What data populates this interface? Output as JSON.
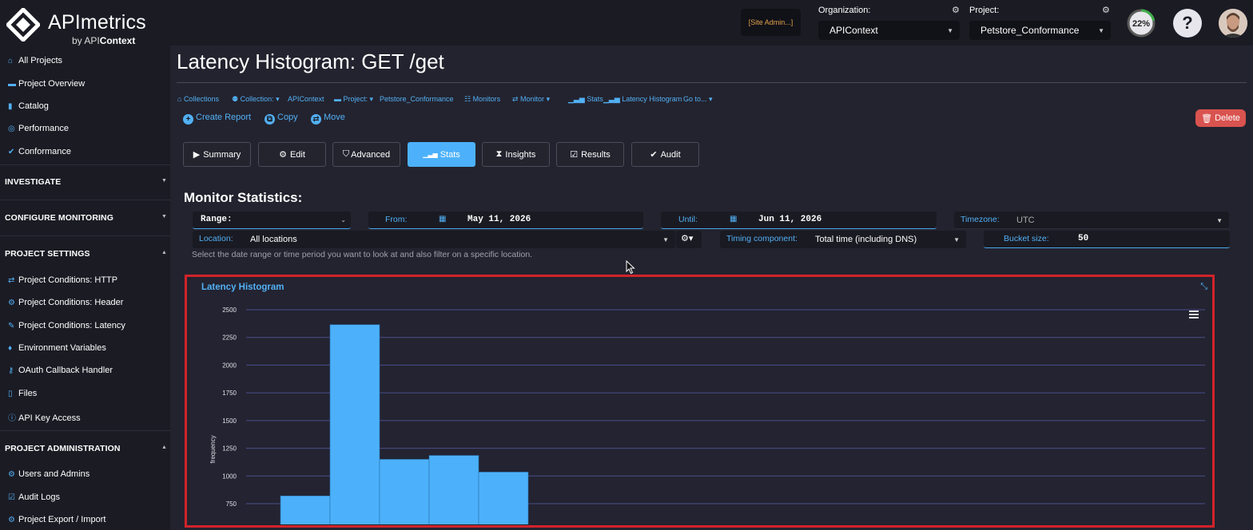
{
  "brand": {
    "title": "APImetrics",
    "sub_prefix": "by API",
    "sub_bold": "Context"
  },
  "header": {
    "site_admin": "[Site Admin...]",
    "org_label": "Organization:",
    "org_value": "APIContext",
    "project_label": "Project:",
    "project_value": "Petstore_Conformance",
    "gauge_text": "22%",
    "gauge_percent": 22,
    "help": "?"
  },
  "sidebar": {
    "top_items": [
      {
        "icon": "home-icon",
        "label": "All Projects"
      },
      {
        "icon": "folder-icon",
        "label": "Project Overview"
      },
      {
        "icon": "book-icon",
        "label": "Catalog"
      },
      {
        "icon": "gauge-icon",
        "label": "Performance"
      },
      {
        "icon": "check-icon",
        "label": "Conformance"
      }
    ],
    "investigate": "INVESTIGATE",
    "configure": "CONFIGURE MONITORING",
    "project_settings": "PROJECT SETTINGS",
    "settings_items": [
      {
        "icon": "exchange-icon",
        "label": "Project Conditions: HTTP"
      },
      {
        "icon": "gear-icon",
        "label": "Project Conditions: Header"
      },
      {
        "icon": "wrench-icon",
        "label": "Project Conditions: Latency"
      },
      {
        "icon": "leaf-icon",
        "label": "Environment Variables"
      },
      {
        "icon": "key-icon",
        "label": "OAuth Callback Handler"
      },
      {
        "icon": "file-icon",
        "label": "Files"
      },
      {
        "icon": "info-icon",
        "label": "API Key Access"
      }
    ],
    "project_admin": "PROJECT ADMINISTRATION",
    "admin_items": [
      {
        "icon": "gear-icon",
        "label": "Users and Admins"
      },
      {
        "icon": "check-square-icon",
        "label": "Audit Logs"
      },
      {
        "icon": "gear-icon",
        "label": "Project Export / Import"
      }
    ]
  },
  "page": {
    "title": "Latency Histogram: GET /get"
  },
  "breadcrumbs": {
    "collections": "Collections",
    "collection": "Collection:",
    "collection_value": "APIContext",
    "project": "Project:",
    "project_value": "Petstore_Conformance",
    "monitors": "Monitors",
    "monitor": "Monitor",
    "stats": "Stats",
    "latency_histogram": "Latency Histogram",
    "goto": "Go to..."
  },
  "actions": {
    "create_report": "Create Report",
    "copy": "Copy",
    "move": "Move",
    "delete": "Delete"
  },
  "tabs": {
    "summary": "Summary",
    "edit": "Edit",
    "advanced": "Advanced",
    "stats": "Stats",
    "insights": "Insights",
    "results": "Results",
    "audit": "Audit"
  },
  "stats": {
    "heading": "Monitor Statistics:",
    "range_label": "Range:",
    "from_label": "From:",
    "from_value": "May 11, 2026",
    "until_label": "Until:",
    "until_value": "Jun 11, 2026",
    "timezone_label": "Timezone:",
    "timezone_value": "UTC",
    "location_label": "Location:",
    "location_value": "All locations",
    "timing_label": "Timing component:",
    "timing_value": "Total time (including DNS)",
    "bucket_label": "Bucket size:",
    "bucket_value": "50",
    "help_text": "Select the date range or time period you want to look at and also filter on a specific location."
  },
  "chart_data": {
    "type": "bar",
    "title": "Latency Histogram",
    "ylabel": "frequency",
    "xlabel": "",
    "yticks": [
      750,
      1000,
      1250,
      1500,
      1750,
      2000,
      2250,
      2500
    ],
    "ylim_visible": [
      575,
      2500
    ],
    "values": [
      820,
      2365,
      1150,
      1185,
      1035
    ],
    "color": "#4cb1fa",
    "grid": true
  }
}
